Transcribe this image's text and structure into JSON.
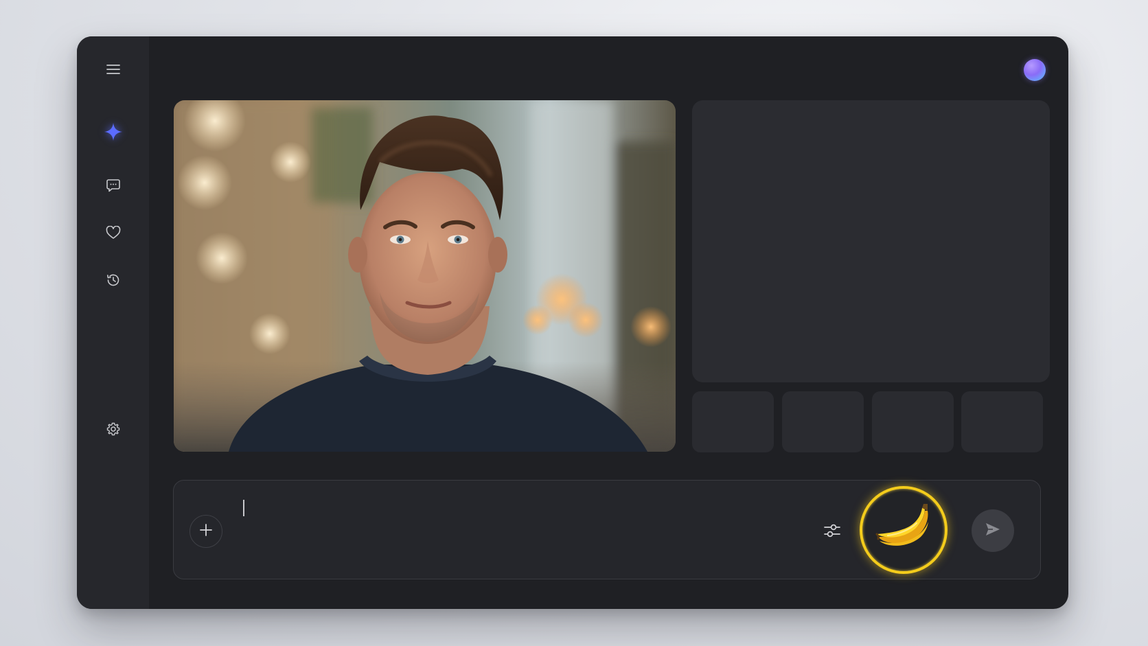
{
  "sidebar": {
    "items": [
      {
        "name": "menu-icon"
      },
      {
        "name": "sparkle-icon",
        "active": true,
        "color": "#5b6cff"
      },
      {
        "name": "chat-icon"
      },
      {
        "name": "heart-icon"
      },
      {
        "name": "history-icon"
      },
      {
        "name": "gear-icon"
      }
    ]
  },
  "header": {
    "avatar_icon": "avatar-gradient"
  },
  "prompt": {
    "value": "",
    "placeholder": ""
  },
  "colors": {
    "accent": "#5b6cff",
    "banana_ring": "#f4cc1c",
    "app_bg": "#1f2024",
    "sidebar_bg": "#26272c"
  }
}
